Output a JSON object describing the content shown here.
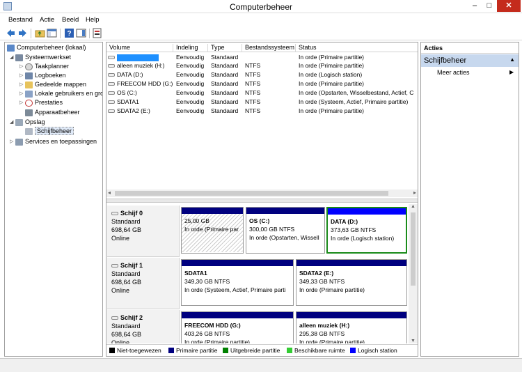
{
  "window": {
    "title": "Computerbeheer",
    "min": "–",
    "max": "□",
    "close": "✕"
  },
  "menu": [
    "Bestand",
    "Actie",
    "Beeld",
    "Help"
  ],
  "toolbar": {
    "help": "?"
  },
  "tree": {
    "root": "Computerbeheer (lokaal)",
    "system_tools": "Systeemwerkset",
    "task_scheduler": "Taakplanner",
    "event_viewer": "Logboeken",
    "shared_folders": "Gedeelde mappen",
    "local_users": "Lokale gebruikers en gro",
    "performance": "Prestaties",
    "device_manager": "Apparaatbeheer",
    "storage": "Opslag",
    "disk_mgmt": "Schijfbeheer",
    "services": "Services en toepassingen"
  },
  "volume_table": {
    "headers": [
      "Volume",
      "Indeling",
      "Type",
      "Bestandssysteem",
      "Status"
    ],
    "rows": [
      {
        "volume": "",
        "layout": "Eenvoudig",
        "type": "Standaard",
        "fs": "",
        "status": "In orde (Primaire partitie)"
      },
      {
        "volume": "alleen muziek (H:)",
        "layout": "Eenvoudig",
        "type": "Standaard",
        "fs": "NTFS",
        "status": "In orde (Primaire partitie)"
      },
      {
        "volume": "DATA (D:)",
        "layout": "Eenvoudig",
        "type": "Standaard",
        "fs": "NTFS",
        "status": "In orde (Logisch station)"
      },
      {
        "volume": "FREECOM HDD (G:)",
        "layout": "Eenvoudig",
        "type": "Standaard",
        "fs": "NTFS",
        "status": "In orde (Primaire partitie)"
      },
      {
        "volume": "OS (C:)",
        "layout": "Eenvoudig",
        "type": "Standaard",
        "fs": "NTFS",
        "status": "In orde (Opstarten, Wisselbestand, Actief, C"
      },
      {
        "volume": "SDATA1",
        "layout": "Eenvoudig",
        "type": "Standaard",
        "fs": "NTFS",
        "status": "In orde (Systeem, Actief, Primaire partitie)"
      },
      {
        "volume": "SDATA2 (E:)",
        "layout": "Eenvoudig",
        "type": "Standaard",
        "fs": "NTFS",
        "status": "In orde (Primaire partitie)"
      }
    ]
  },
  "disks": [
    {
      "name": "Schijf 0",
      "type": "Standaard",
      "size": "698,64 GB",
      "state": "Online",
      "partitions": [
        {
          "title": "",
          "size": "25,00 GB",
          "status": "In orde (Primaire par"
        },
        {
          "title": "OS  (C:)",
          "size": "300,00 GB NTFS",
          "status": "In orde (Opstarten, Wissell"
        },
        {
          "title": "DATA  (D:)",
          "size": "373,63 GB NTFS",
          "status": "In orde (Logisch station)"
        }
      ]
    },
    {
      "name": "Schijf 1",
      "type": "Standaard",
      "size": "698,64 GB",
      "state": "Online",
      "partitions": [
        {
          "title": "SDATA1",
          "size": "349,30 GB NTFS",
          "status": "In orde (Systeem, Actief, Primaire parti"
        },
        {
          "title": "SDATA2  (E:)",
          "size": "349,33 GB NTFS",
          "status": "In orde (Primaire partitie)"
        }
      ]
    },
    {
      "name": "Schijf 2",
      "type": "Standaard",
      "size": "698,64 GB",
      "state": "Online",
      "partitions": [
        {
          "title": "FREECOM HDD  (G:)",
          "size": "403,26 GB NTFS",
          "status": "In orde (Primaire partitie)"
        },
        {
          "title": "alleen muziek  (H:)",
          "size": "295,38 GB NTFS",
          "status": "In orde (Primaire partitie)"
        }
      ]
    }
  ],
  "legend": [
    {
      "label": "Niet-toegewezen",
      "color": "#000000"
    },
    {
      "label": "Primaire partitie",
      "color": "#00007f"
    },
    {
      "label": "Uitgebreide partitie",
      "color": "#008000"
    },
    {
      "label": "Beschikbare ruimte",
      "color": "#33cc33"
    },
    {
      "label": "Logisch station",
      "color": "#0000ff"
    }
  ],
  "actions": {
    "title": "Acties",
    "section": "Schijfbeheer",
    "more": "Meer acties"
  },
  "colors": {
    "primary": "#00007f",
    "logical": "#0000ff",
    "selection_border": "#1a8b1a",
    "actions_section": "#c7d8ee"
  }
}
